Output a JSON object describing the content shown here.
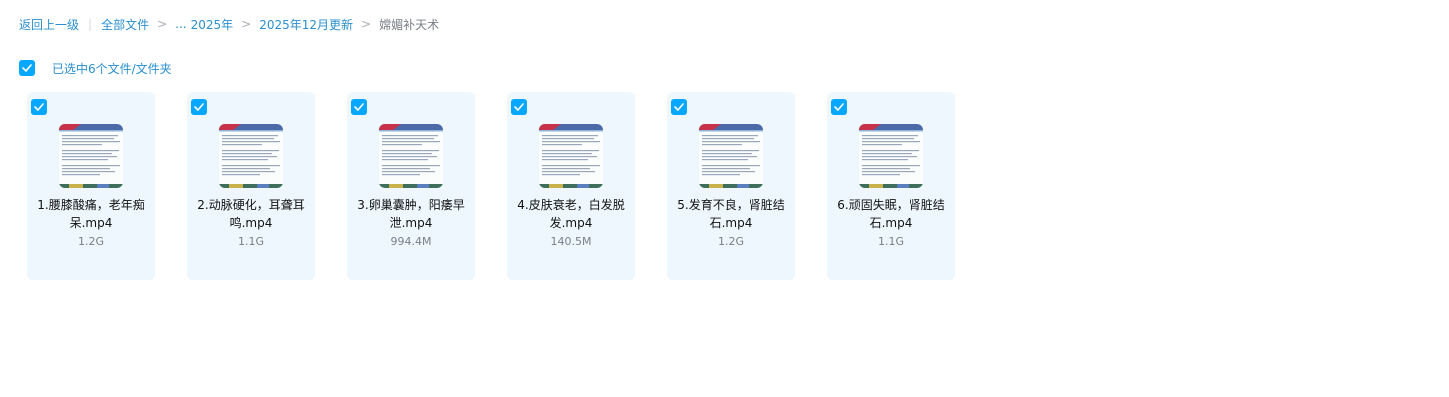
{
  "breadcrumb": {
    "back": "返回上一级",
    "all_files": "全部文件",
    "ellipsis": "...",
    "year": "2025年",
    "month": "2025年12月更新",
    "current": "嫦媚补天术"
  },
  "selection": {
    "label": "已选中6个文件/文件夹",
    "checked": true
  },
  "files": [
    {
      "name": "1.腰膝酸痛，老年痴呆.mp4",
      "size": "1.2G",
      "checked": true
    },
    {
      "name": "2.动脉硬化，耳聋耳鸣.mp4",
      "size": "1.1G",
      "checked": true
    },
    {
      "name": "3.卵巢囊肿，阳痿早泄.mp4",
      "size": "994.4M",
      "checked": true
    },
    {
      "name": "4.皮肤衰老，白发脱发.mp4",
      "size": "140.5M",
      "checked": true
    },
    {
      "name": "5.发育不良，肾脏结石.mp4",
      "size": "1.2G",
      "checked": true
    },
    {
      "name": "6.顽固失眠，肾脏结石.mp4",
      "size": "1.1G",
      "checked": true
    }
  ],
  "colors": {
    "accent": "#06a7ff",
    "link": "#2a8fd0",
    "card_bg": "#eef7fe"
  },
  "icons": {
    "checkbox": "checkmark-icon",
    "thumbnail": "video-thumbnail"
  }
}
